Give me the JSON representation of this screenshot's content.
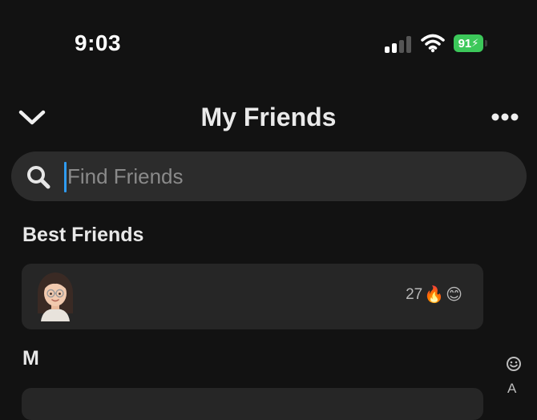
{
  "status_bar": {
    "time": "9:03",
    "battery_level": "91",
    "battery_charging": true,
    "signal_bars": 4,
    "signal_bars_active": 2,
    "wifi": "wifi-icon",
    "colors": {
      "battery": "#3cc85a",
      "signal_active": "#ffffff",
      "signal_inactive": "#555555"
    }
  },
  "header": {
    "title": "My Friends",
    "back_icon": "chevron-down-icon",
    "more_icon": "more-horizontal-icon"
  },
  "search": {
    "placeholder": "Find Friends",
    "value": "",
    "icon": "search-icon",
    "caret_color": "#2f9bf0"
  },
  "sections": [
    {
      "title": "Best Friends",
      "friends": [
        {
          "avatar": "bitmoji-avatar",
          "name": "",
          "streak_count": "27",
          "streak_emoji": "🔥",
          "status_emoji": "😊"
        }
      ]
    },
    {
      "title": "M",
      "friends": []
    }
  ],
  "alphabet_index": {
    "emoji_icon": "smiley-icon",
    "letters": [
      "A"
    ]
  },
  "colors": {
    "background": "#121212",
    "card": "#262626",
    "search_field": "#2c2c2c"
  }
}
